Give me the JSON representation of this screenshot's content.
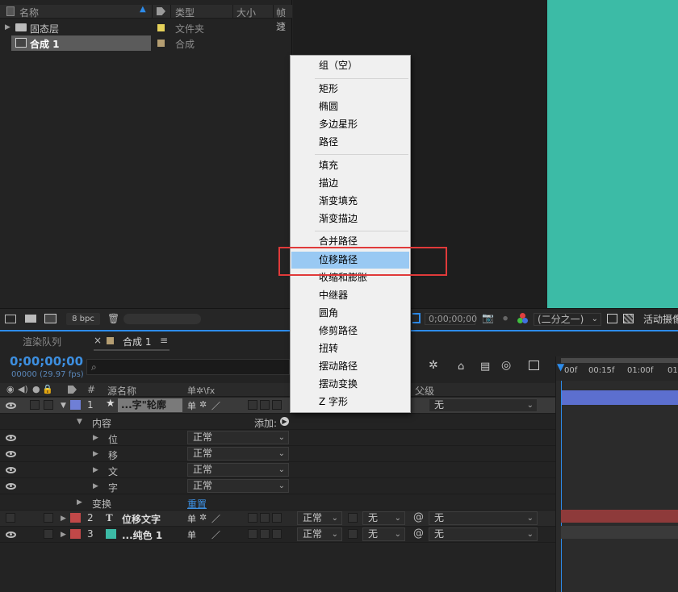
{
  "project": {
    "columns": {
      "name": "名称",
      "type": "类型",
      "size": "大小",
      "framerate": "帧速"
    },
    "items": [
      {
        "name": "固态层",
        "type": "文件夹",
        "color": "#e6d25a"
      },
      {
        "name": "合成 1",
        "type": "合成",
        "color": "#b59e72"
      }
    ],
    "bpc": "8 bpc"
  },
  "viewer": {
    "timecode": "0;00;00;00",
    "resolution": "(二分之一)",
    "active_camera": "活动摄像"
  },
  "timeline": {
    "tabs": {
      "render_queue": "渲染队列",
      "comp": "合成 1"
    },
    "current_time": "0;00;00;00",
    "fps": "00000 (29.97 fps)",
    "search_placeholder": "",
    "headers": {
      "hash": "#",
      "source_name": "源名称",
      "switches": "单✲\\fx",
      "parent": "父级"
    },
    "ruler": [
      "00f",
      "00:15f",
      "01:00f",
      "01"
    ],
    "layer1": {
      "num": "1",
      "name": "...字\"轮廓",
      "parent": "无"
    },
    "contents_label": "内容",
    "add_label": "添加:",
    "subitems": [
      {
        "name": "位",
        "mode": "正常"
      },
      {
        "name": "移",
        "mode": "正常"
      },
      {
        "name": "文",
        "mode": "正常"
      },
      {
        "name": "字",
        "mode": "正常"
      }
    ],
    "transform_label": "变换",
    "reset_label": "重置",
    "layer2": {
      "num": "2",
      "name": "位移文字",
      "mode": "正常",
      "track": "无",
      "parent": "无"
    },
    "layer3": {
      "num": "3",
      "name": "...纯色 1",
      "mode": "正常",
      "track": "无",
      "parent": "无"
    },
    "colors": {
      "layer1": "#6f7fd6",
      "layer2": "#c04848",
      "layer3": "#c04848",
      "teal": "#3cbba6"
    }
  },
  "menu": {
    "groups": [
      [
        "组（空）"
      ],
      [
        "矩形",
        "椭圆",
        "多边星形",
        "路径"
      ],
      [
        "填充",
        "描边",
        "渐变填充",
        "渐变描边"
      ],
      [
        "合并路径",
        "位移路径",
        "收缩和膨胀",
        "中继器",
        "圆角",
        "修剪路径",
        "扭转",
        "摆动路径",
        "摆动变换",
        "Z 字形"
      ]
    ],
    "highlighted": "位移路径"
  }
}
